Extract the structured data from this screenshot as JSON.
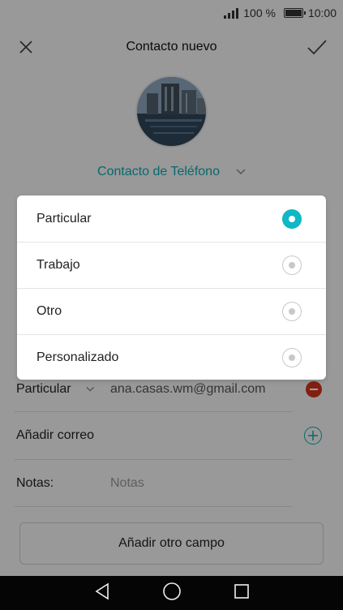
{
  "status": {
    "battery": "100 %",
    "time": "10:00"
  },
  "app_bar": {
    "title": "Contacto nuevo",
    "close_icon": "close-icon",
    "confirm_icon": "check-icon"
  },
  "account": {
    "label": "Contacto de Teléfono"
  },
  "email": {
    "type": "Particular",
    "value": "ana.casas.wm@gmail.com"
  },
  "add_email": {
    "label": "Añadir correo"
  },
  "notes": {
    "label": "Notas:",
    "placeholder": "Notas"
  },
  "add_field": {
    "label": "Añadir otro campo"
  },
  "dialog": {
    "options": [
      {
        "label": "Particular",
        "selected": true
      },
      {
        "label": "Trabajo",
        "selected": false
      },
      {
        "label": "Otro",
        "selected": false
      },
      {
        "label": "Personalizado",
        "selected": false
      }
    ]
  },
  "colors": {
    "accent": "#10b7c4",
    "accent_text": "#10a8b0",
    "remove": "#d1351c"
  }
}
